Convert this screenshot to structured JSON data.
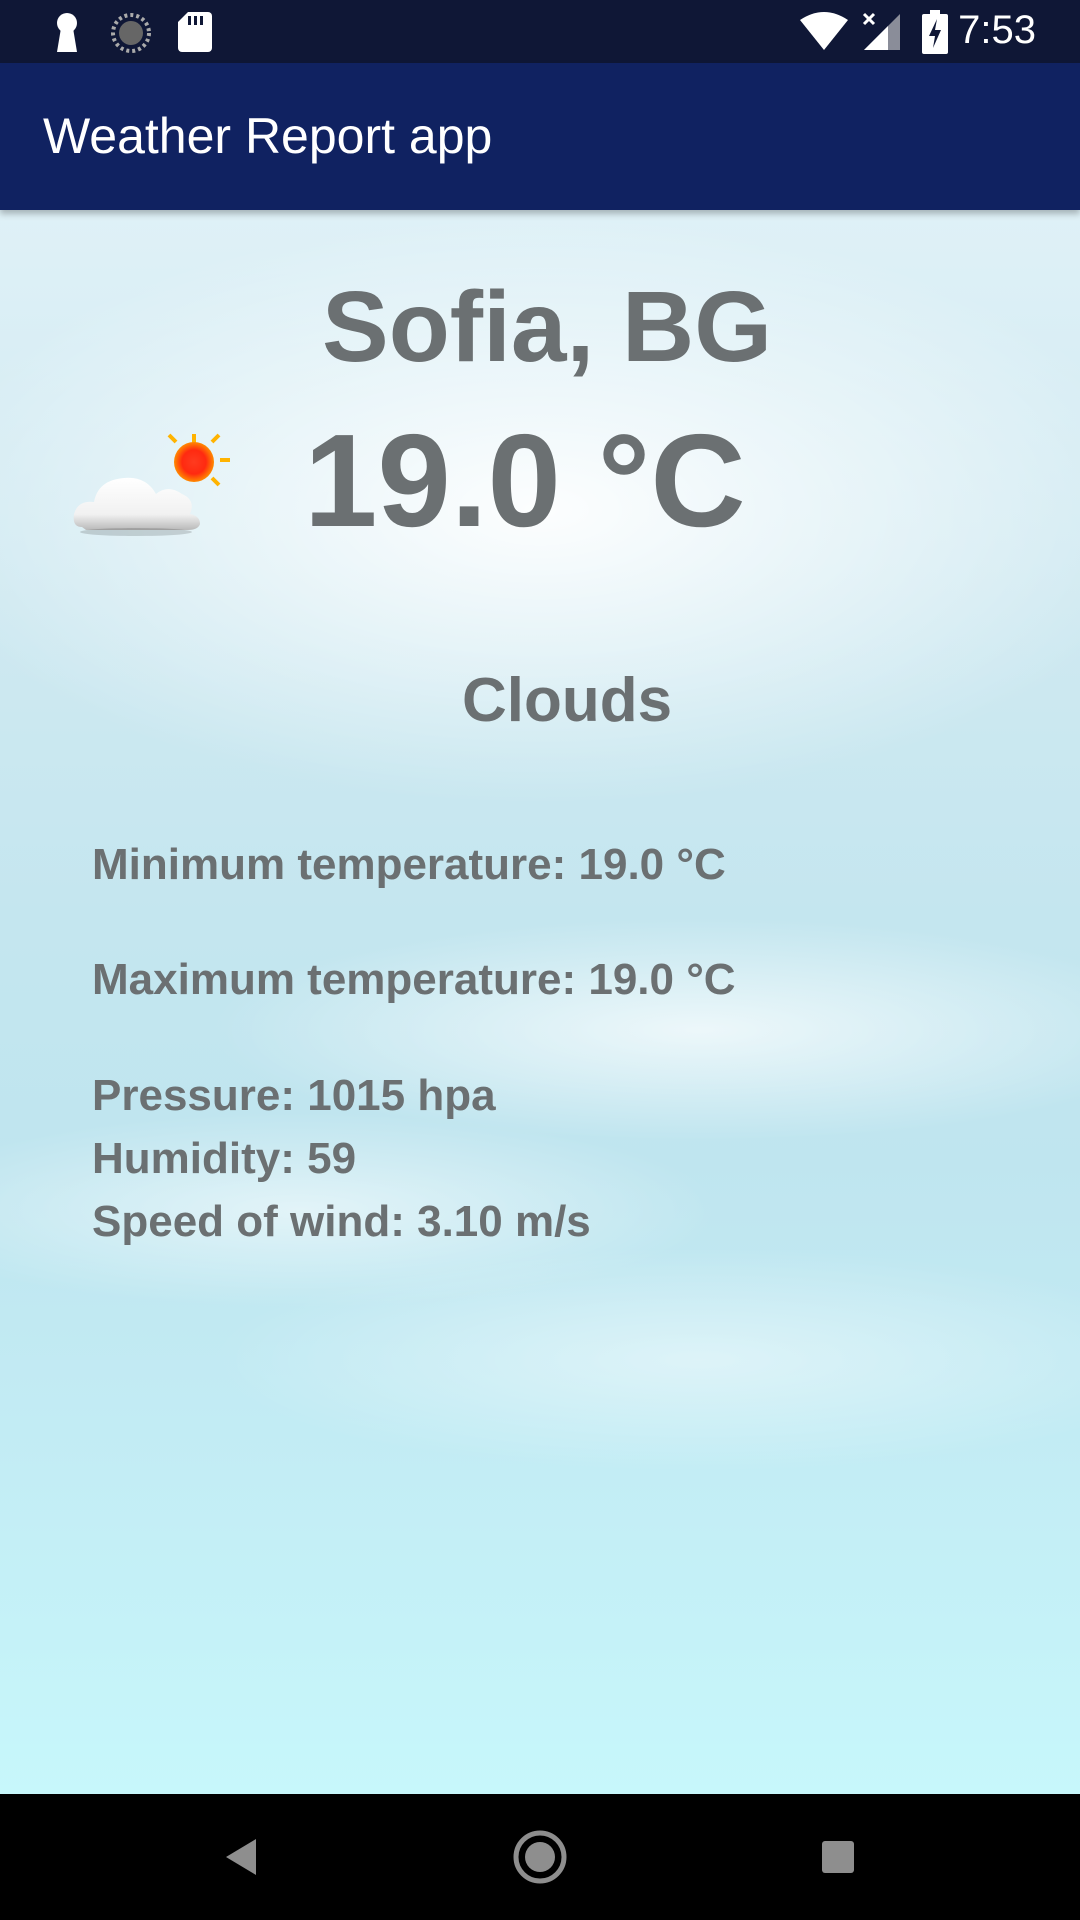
{
  "status_bar": {
    "time": "7:53",
    "icons": [
      "keyhole-icon",
      "sync-icon",
      "sd-card-icon",
      "wifi-icon",
      "signal-icon",
      "battery-charging-icon"
    ]
  },
  "app_bar": {
    "title": "Weather Report app"
  },
  "weather": {
    "city": "Sofia, BG",
    "temperature": "19.0 °C",
    "condition": "Clouds",
    "icon": "partly-cloudy-icon",
    "min_temp": "Minimum temperature: 19.0 °C",
    "max_temp": "Maximum temperature: 19.0 °C",
    "pressure": "Pressure: 1015 hpa",
    "humidity": "Humidity: 59",
    "wind": "Speed of wind: 3.10 m/s"
  },
  "nav_bar": {
    "buttons": [
      "back-icon",
      "home-icon",
      "recents-icon"
    ]
  },
  "colors": {
    "status_bar": "#0f1736",
    "app_bar": "#102261",
    "text": "#6b7072"
  }
}
